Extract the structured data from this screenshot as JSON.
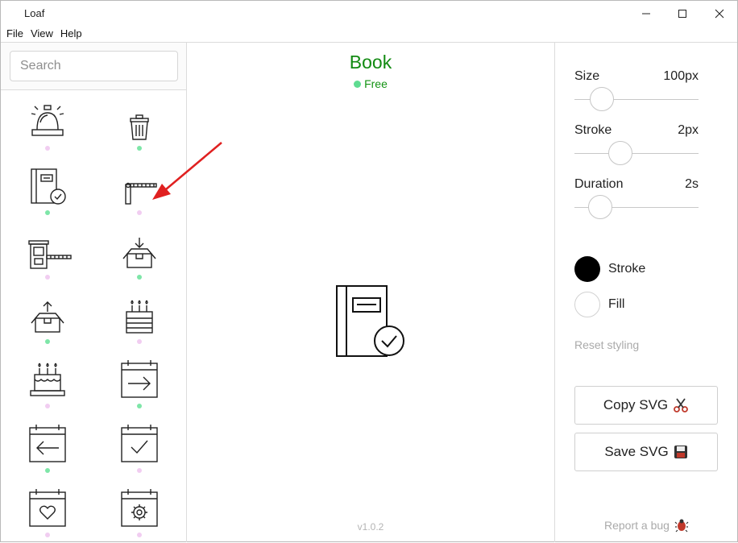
{
  "app": {
    "title": "Loaf"
  },
  "menu": {
    "items": [
      "File",
      "View",
      "Help"
    ]
  },
  "search": {
    "placeholder": "Search",
    "value": ""
  },
  "icons": [
    {
      "icon": "bell-icon",
      "status": "paid"
    },
    {
      "icon": "trash-icon",
      "status": "free"
    },
    {
      "icon": "book-icon",
      "status": "free"
    },
    {
      "icon": "barrier-icon",
      "status": "paid"
    },
    {
      "icon": "toll-booth-icon",
      "status": "paid"
    },
    {
      "icon": "box-in-icon",
      "status": "free"
    },
    {
      "icon": "box-out-icon",
      "status": "free"
    },
    {
      "icon": "cake-icon",
      "status": "paid"
    },
    {
      "icon": "birthday-cake-icon",
      "status": "paid"
    },
    {
      "icon": "calendar-next-icon",
      "status": "free"
    },
    {
      "icon": "calendar-previous-icon",
      "status": "free"
    },
    {
      "icon": "calendar-check-icon",
      "status": "paid"
    },
    {
      "icon": "calendar-heart-icon",
      "status": "paid"
    },
    {
      "icon": "calendar-gear-icon",
      "status": "paid"
    }
  ],
  "preview": {
    "name": "Book",
    "license": "Free",
    "icon": "book-icon"
  },
  "version": "v1.0.2",
  "settings": {
    "size": {
      "label": "Size",
      "value": "100px",
      "level": 0.15
    },
    "stroke": {
      "label": "Stroke",
      "value": "2px",
      "level": 0.34
    },
    "duration": {
      "label": "Duration",
      "value": "2s",
      "level": 0.14
    }
  },
  "styling": {
    "stroke_label": "Stroke",
    "fill_label": "Fill",
    "stroke_color": "#000000",
    "fill_color": "#ffffff",
    "reset_label": "Reset styling"
  },
  "actions": {
    "copy_label": "Copy SVG",
    "copy_icon": "scissors-icon",
    "save_label": "Save SVG",
    "save_icon": "floppy-disk-icon"
  },
  "report": {
    "label": "Report a bug",
    "icon": "bug-icon"
  },
  "colors": {
    "title_green": "#118a11",
    "free_dot": "#7ee6a8",
    "paid_dot": "#f1cdf1",
    "arrow": "#e02020"
  }
}
